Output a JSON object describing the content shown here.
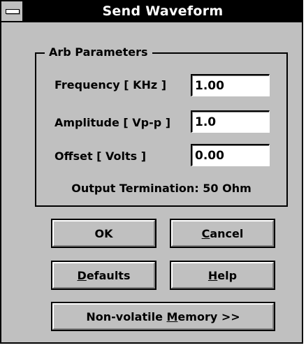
{
  "window": {
    "title": "Send Waveform"
  },
  "group": {
    "label": "Arb Parameters"
  },
  "fields": {
    "frequency": {
      "label": "Frequency [ KHz ]",
      "value": "1.00"
    },
    "amplitude": {
      "label": "Amplitude [ Vp-p ]",
      "value": "1.0"
    },
    "offset": {
      "label": "Offset [ Volts ]",
      "value": "0.00"
    }
  },
  "output_termination": "Output Termination: 50 Ohm",
  "buttons": {
    "ok": {
      "label": "OK"
    },
    "cancel": {
      "pre": "",
      "mnemonic": "C",
      "post": "ancel"
    },
    "defaults": {
      "pre": "",
      "mnemonic": "D",
      "post": "efaults"
    },
    "help": {
      "pre": "",
      "mnemonic": "H",
      "post": "elp"
    },
    "memory": {
      "pre": "Non-volatile ",
      "mnemonic": "M",
      "post": "emory >>"
    }
  },
  "colors": {
    "face": "#c0c0c0",
    "titlebar": "#000000",
    "title_text": "#ffffff",
    "field_bg": "#ffffff"
  }
}
